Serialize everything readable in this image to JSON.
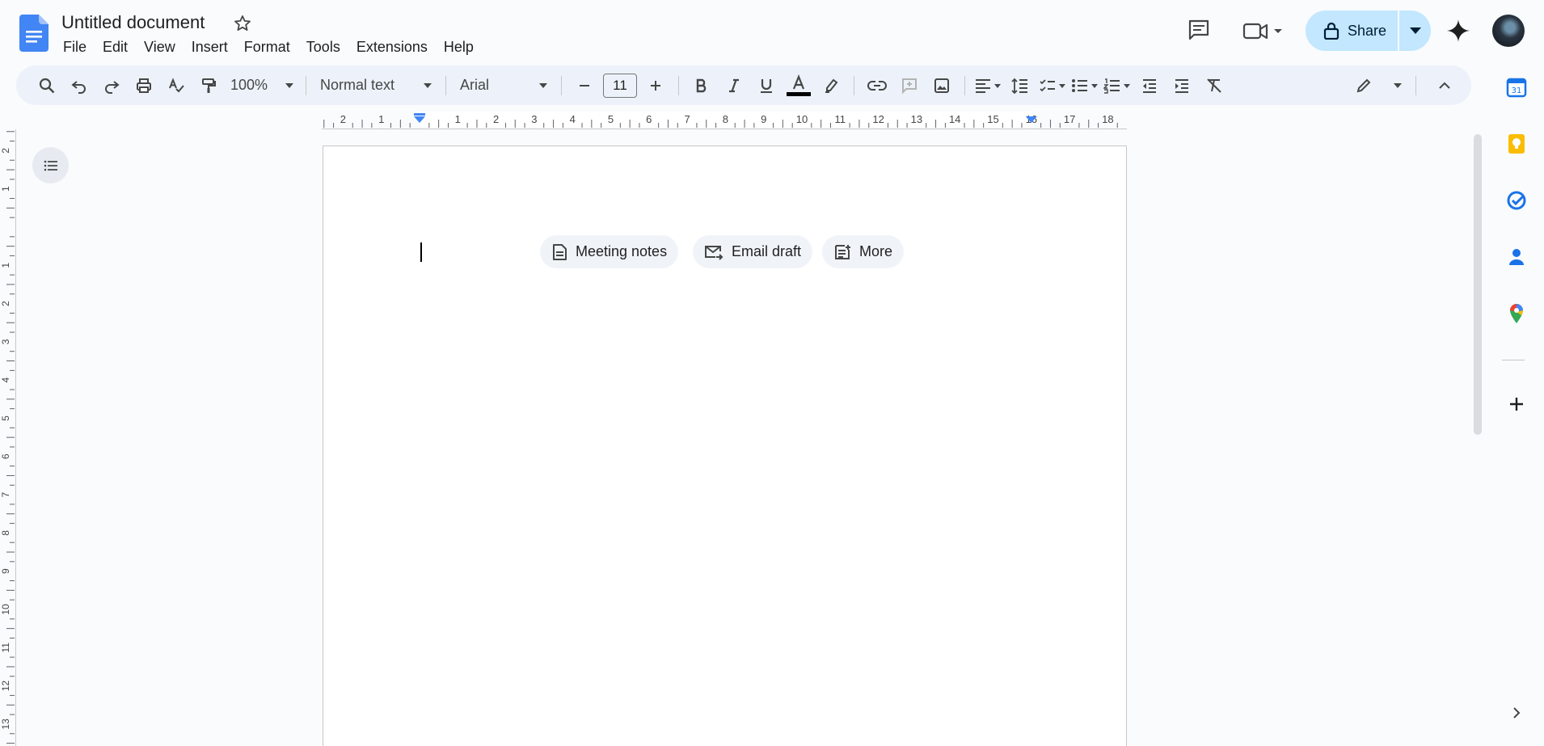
{
  "document": {
    "title": "Untitled document"
  },
  "menubar": [
    "File",
    "Edit",
    "View",
    "Insert",
    "Format",
    "Tools",
    "Extensions",
    "Help"
  ],
  "header": {
    "share_label": "Share"
  },
  "toolbar": {
    "zoom": "100%",
    "paragraph_style": "Normal text",
    "font_family": "Arial",
    "font_size": "11",
    "text_color": "#000000"
  },
  "ruler": {
    "horizontal_labels": [
      "2",
      "1",
      "1",
      "2",
      "3",
      "4",
      "5",
      "6",
      "7",
      "8",
      "9",
      "10",
      "11",
      "12",
      "13",
      "14",
      "15",
      "16",
      "17",
      "18"
    ],
    "vertical_labels": [
      "2",
      "1",
      "1",
      "2",
      "3",
      "4",
      "5",
      "6",
      "7",
      "8",
      "9",
      "10",
      "11",
      "12",
      "13"
    ]
  },
  "smart_chips": {
    "meeting_notes": "Meeting notes",
    "email_draft": "Email draft",
    "more": "More"
  },
  "colors": {
    "accent": "#0b57d0",
    "share_bg": "#c2e7ff",
    "toolbar_bg": "#edf2fa"
  },
  "side_panel": [
    "calendar-icon",
    "keep-icon",
    "tasks-icon",
    "contacts-icon",
    "maps-icon",
    "add-icon"
  ]
}
